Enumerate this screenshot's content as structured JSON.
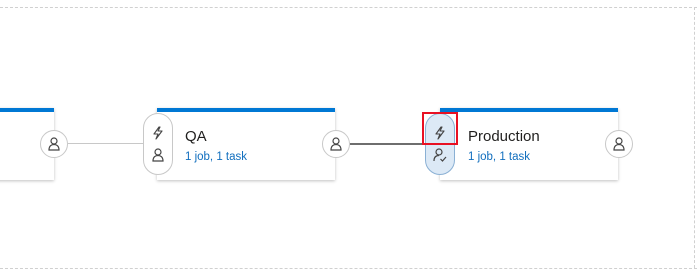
{
  "colors": {
    "accent": "#0078d4",
    "link": "#106ebe",
    "highlight": "#dce9f6",
    "selection_box": "#e81123"
  },
  "stages": [
    {
      "name": "",
      "summary": ""
    },
    {
      "name": "QA",
      "summary": "1 job, 1 task"
    },
    {
      "name": "Production",
      "summary": "1 job, 1 task"
    }
  ],
  "icons": {
    "trigger": "lightning-bolt-icon",
    "pre_approver": "person-icon",
    "pre_approver_configured": "person-check-icon",
    "post_approver": "person-icon"
  }
}
